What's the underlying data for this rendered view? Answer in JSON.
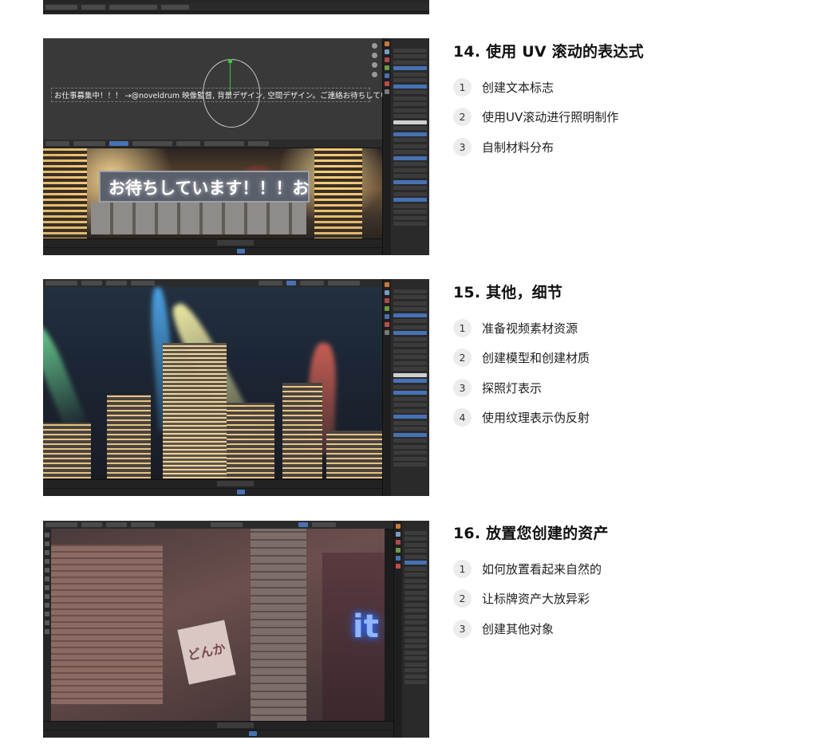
{
  "sections": [
    {
      "title": "14. 使用 UV 滚动的表达式",
      "items": [
        {
          "num": "1",
          "text": "创建文本标志"
        },
        {
          "num": "2",
          "text": "使用UV滚动进行照明制作"
        },
        {
          "num": "3",
          "text": "自制材料分布"
        }
      ],
      "screenshot": {
        "edit_text": "お仕事募集中！！！ →@noveldrum 映像監督, 背景デザイン, 空間デザイン。ご連絡お待ちしています！！！",
        "sign_text": "お待ちしています！！！お"
      }
    },
    {
      "title": "15. 其他，细节",
      "items": [
        {
          "num": "1",
          "text": "准备视频素材资源"
        },
        {
          "num": "2",
          "text": "创建模型和创建材质"
        },
        {
          "num": "3",
          "text": "探照灯表示"
        },
        {
          "num": "4",
          "text": "使用纹理表示伪反射"
        }
      ]
    },
    {
      "title": "16. 放置您创建的资产",
      "items": [
        {
          "num": "1",
          "text": "如何放置看起来自然的"
        },
        {
          "num": "2",
          "text": "让标牌资产大放异彩"
        },
        {
          "num": "3",
          "text": "创建其他对象"
        }
      ],
      "screenshot": {
        "neon_sign": "it",
        "kana_sign": "どんか"
      }
    }
  ],
  "colors": {
    "blender_accent": "#4772b3",
    "number_badge_bg": "#ececec"
  }
}
